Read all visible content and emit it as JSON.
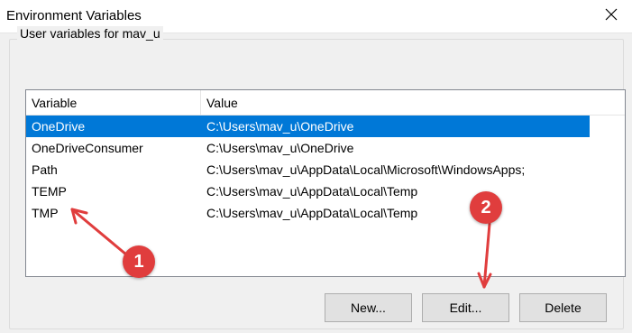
{
  "window": {
    "title": "Environment Variables",
    "close_icon": "close-icon"
  },
  "group": {
    "label": "User variables for mav_u"
  },
  "table": {
    "columns": [
      "Variable",
      "Value"
    ],
    "rows": [
      {
        "variable": "OneDrive",
        "value": "C:\\Users\\mav_u\\OneDrive",
        "selected": true
      },
      {
        "variable": "OneDriveConsumer",
        "value": "C:\\Users\\mav_u\\OneDrive",
        "selected": false
      },
      {
        "variable": "Path",
        "value": "C:\\Users\\mav_u\\AppData\\Local\\Microsoft\\WindowsApps;",
        "selected": false
      },
      {
        "variable": "TEMP",
        "value": "C:\\Users\\mav_u\\AppData\\Local\\Temp",
        "selected": false
      },
      {
        "variable": "TMP",
        "value": "C:\\Users\\mav_u\\AppData\\Local\\Temp",
        "selected": false
      }
    ]
  },
  "buttons": {
    "new_label": "New...",
    "edit_label": "Edit...",
    "delete_label": "Delete"
  },
  "annotations": {
    "badge1": "1",
    "badge2": "2"
  },
  "colors": {
    "selection": "#0078d7",
    "badge": "#e03d3d"
  }
}
